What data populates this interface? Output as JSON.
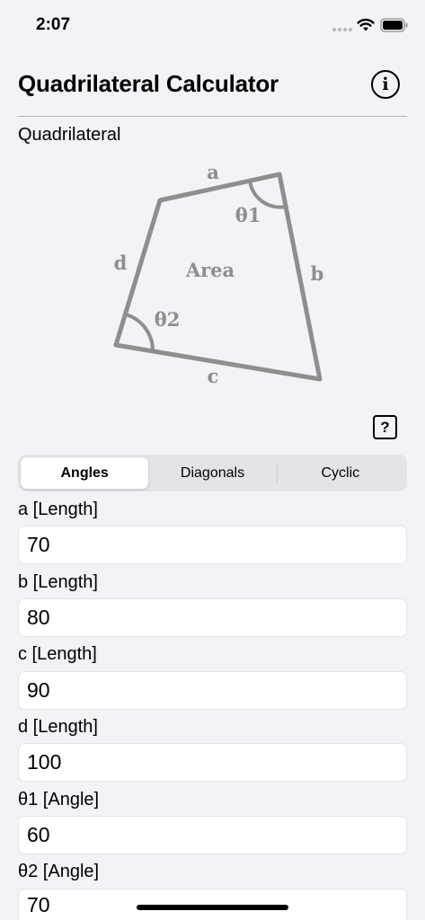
{
  "status": {
    "time": "2:07"
  },
  "header": {
    "title": "Quadrilateral Calculator"
  },
  "section": {
    "label": "Quadrilateral"
  },
  "diagram": {
    "side_a": "a",
    "side_b": "b",
    "side_c": "c",
    "side_d": "d",
    "area": "Area",
    "angle_1": "θ1",
    "angle_2": "θ2",
    "stroke_color": "#8e8e8e"
  },
  "help": {
    "label": "?"
  },
  "modes": [
    {
      "label": "Angles",
      "selected": true
    },
    {
      "label": "Diagonals",
      "selected": false
    },
    {
      "label": "Cyclic",
      "selected": false
    }
  ],
  "fields": [
    {
      "label": "a [Length]",
      "value": "70"
    },
    {
      "label": "b [Length]",
      "value": "80"
    },
    {
      "label": "c [Length]",
      "value": "90"
    },
    {
      "label": "d [Length]",
      "value": "100"
    },
    {
      "label": "θ1 [Angle]",
      "value": "60"
    },
    {
      "label": "θ2 [Angle]",
      "value": "70"
    }
  ],
  "icons": {
    "info": "info-circle-icon",
    "wifi": "wifi-icon",
    "battery": "battery-icon",
    "help": "question-mark-icon"
  }
}
